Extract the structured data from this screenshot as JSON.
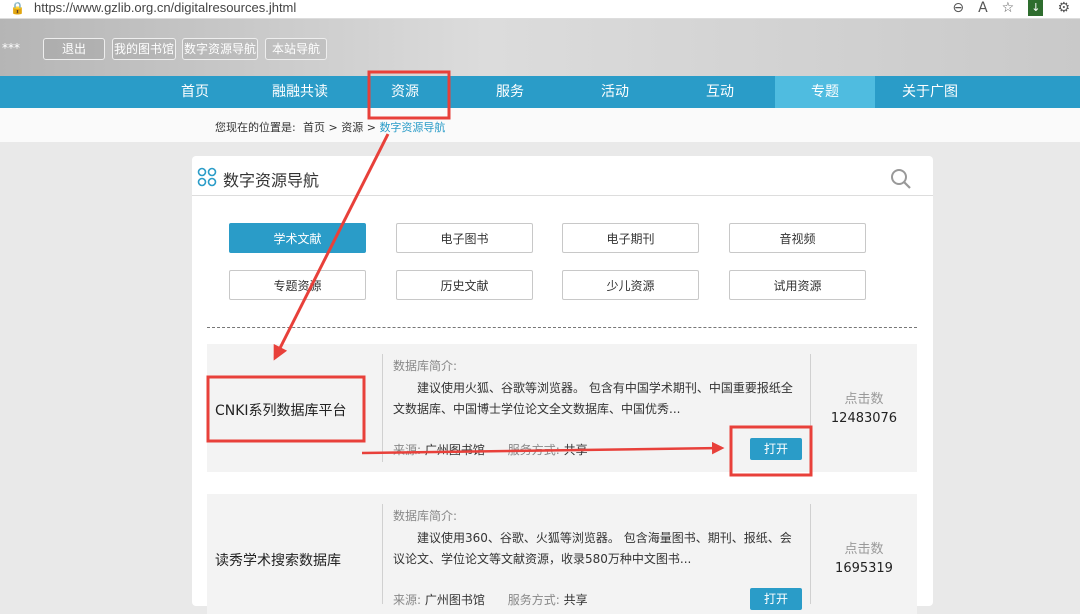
{
  "browser": {
    "url": "https://www.gzlib.org.cn/digitalresources.jhtml"
  },
  "header": {
    "masked_user": "***",
    "buttons": [
      "退出",
      "我的图书馆",
      "数字资源导航",
      "本站导航"
    ]
  },
  "nav": {
    "items": [
      "首页",
      "融融共读",
      "资源",
      "服务",
      "活动",
      "互动",
      "专题",
      "关于广图"
    ],
    "active": "专题"
  },
  "breadcrumb": {
    "label": "您现在的位置是:",
    "items": [
      "首页",
      "资源",
      "数字资源导航"
    ]
  },
  "panel": {
    "title": "数字资源导航"
  },
  "tabs": [
    "学术文献",
    "电子图书",
    "电子期刊",
    "音视频",
    "专题资源",
    "历史文献",
    "少儿资源",
    "试用资源"
  ],
  "active_tab": "学术文献",
  "resources": [
    {
      "name": "CNKI系列数据库平台",
      "intro_label": "数据库简介:",
      "description": "建议使用火狐、谷歌等浏览器。 包含有中国学术期刊、中国重要报纸全文数据库、中国博士学位论文全文数据库、中国优秀...",
      "source_label": "来源:",
      "source": "广州图书馆",
      "service_label": "服务方式:",
      "service": "共享",
      "open_label": "打开",
      "clicks_label": "点击数",
      "clicks": "12483076"
    },
    {
      "name": "读秀学术搜索数据库",
      "intro_label": "数据库简介:",
      "description": "建议使用360、谷歌、火狐等浏览器。 包含海量图书、期刊、报纸、会议论文、学位论文等文献资源，收录580万种中文图书...",
      "source_label": "来源:",
      "source": "广州图书馆",
      "service_label": "服务方式:",
      "service": "共享",
      "open_label": "打开",
      "clicks_label": "点击数",
      "clicks": "1695319"
    }
  ],
  "colors": {
    "nav_bg": "#2a9cc8",
    "accent": "#2a9cc8",
    "annotation": "#e8403a"
  }
}
